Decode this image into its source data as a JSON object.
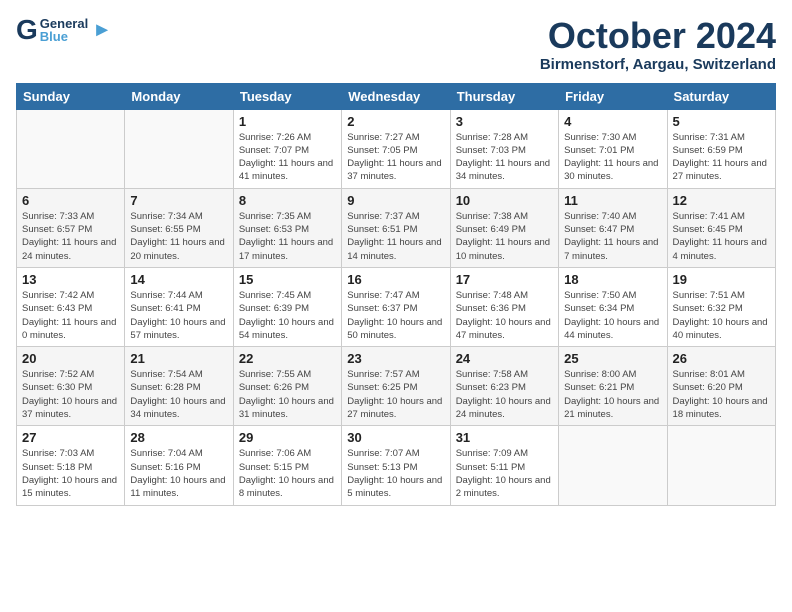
{
  "header": {
    "logo_general": "General",
    "logo_blue": "Blue",
    "month": "October 2024",
    "location": "Birmenstorf, Aargau, Switzerland"
  },
  "days_of_week": [
    "Sunday",
    "Monday",
    "Tuesday",
    "Wednesday",
    "Thursday",
    "Friday",
    "Saturday"
  ],
  "weeks": [
    [
      {
        "day": "",
        "info": ""
      },
      {
        "day": "",
        "info": ""
      },
      {
        "day": "1",
        "info": "Sunrise: 7:26 AM\nSunset: 7:07 PM\nDaylight: 11 hours and 41 minutes."
      },
      {
        "day": "2",
        "info": "Sunrise: 7:27 AM\nSunset: 7:05 PM\nDaylight: 11 hours and 37 minutes."
      },
      {
        "day": "3",
        "info": "Sunrise: 7:28 AM\nSunset: 7:03 PM\nDaylight: 11 hours and 34 minutes."
      },
      {
        "day": "4",
        "info": "Sunrise: 7:30 AM\nSunset: 7:01 PM\nDaylight: 11 hours and 30 minutes."
      },
      {
        "day": "5",
        "info": "Sunrise: 7:31 AM\nSunset: 6:59 PM\nDaylight: 11 hours and 27 minutes."
      }
    ],
    [
      {
        "day": "6",
        "info": "Sunrise: 7:33 AM\nSunset: 6:57 PM\nDaylight: 11 hours and 24 minutes."
      },
      {
        "day": "7",
        "info": "Sunrise: 7:34 AM\nSunset: 6:55 PM\nDaylight: 11 hours and 20 minutes."
      },
      {
        "day": "8",
        "info": "Sunrise: 7:35 AM\nSunset: 6:53 PM\nDaylight: 11 hours and 17 minutes."
      },
      {
        "day": "9",
        "info": "Sunrise: 7:37 AM\nSunset: 6:51 PM\nDaylight: 11 hours and 14 minutes."
      },
      {
        "day": "10",
        "info": "Sunrise: 7:38 AM\nSunset: 6:49 PM\nDaylight: 11 hours and 10 minutes."
      },
      {
        "day": "11",
        "info": "Sunrise: 7:40 AM\nSunset: 6:47 PM\nDaylight: 11 hours and 7 minutes."
      },
      {
        "day": "12",
        "info": "Sunrise: 7:41 AM\nSunset: 6:45 PM\nDaylight: 11 hours and 4 minutes."
      }
    ],
    [
      {
        "day": "13",
        "info": "Sunrise: 7:42 AM\nSunset: 6:43 PM\nDaylight: 11 hours and 0 minutes."
      },
      {
        "day": "14",
        "info": "Sunrise: 7:44 AM\nSunset: 6:41 PM\nDaylight: 10 hours and 57 minutes."
      },
      {
        "day": "15",
        "info": "Sunrise: 7:45 AM\nSunset: 6:39 PM\nDaylight: 10 hours and 54 minutes."
      },
      {
        "day": "16",
        "info": "Sunrise: 7:47 AM\nSunset: 6:37 PM\nDaylight: 10 hours and 50 minutes."
      },
      {
        "day": "17",
        "info": "Sunrise: 7:48 AM\nSunset: 6:36 PM\nDaylight: 10 hours and 47 minutes."
      },
      {
        "day": "18",
        "info": "Sunrise: 7:50 AM\nSunset: 6:34 PM\nDaylight: 10 hours and 44 minutes."
      },
      {
        "day": "19",
        "info": "Sunrise: 7:51 AM\nSunset: 6:32 PM\nDaylight: 10 hours and 40 minutes."
      }
    ],
    [
      {
        "day": "20",
        "info": "Sunrise: 7:52 AM\nSunset: 6:30 PM\nDaylight: 10 hours and 37 minutes."
      },
      {
        "day": "21",
        "info": "Sunrise: 7:54 AM\nSunset: 6:28 PM\nDaylight: 10 hours and 34 minutes."
      },
      {
        "day": "22",
        "info": "Sunrise: 7:55 AM\nSunset: 6:26 PM\nDaylight: 10 hours and 31 minutes."
      },
      {
        "day": "23",
        "info": "Sunrise: 7:57 AM\nSunset: 6:25 PM\nDaylight: 10 hours and 27 minutes."
      },
      {
        "day": "24",
        "info": "Sunrise: 7:58 AM\nSunset: 6:23 PM\nDaylight: 10 hours and 24 minutes."
      },
      {
        "day": "25",
        "info": "Sunrise: 8:00 AM\nSunset: 6:21 PM\nDaylight: 10 hours and 21 minutes."
      },
      {
        "day": "26",
        "info": "Sunrise: 8:01 AM\nSunset: 6:20 PM\nDaylight: 10 hours and 18 minutes."
      }
    ],
    [
      {
        "day": "27",
        "info": "Sunrise: 7:03 AM\nSunset: 5:18 PM\nDaylight: 10 hours and 15 minutes."
      },
      {
        "day": "28",
        "info": "Sunrise: 7:04 AM\nSunset: 5:16 PM\nDaylight: 10 hours and 11 minutes."
      },
      {
        "day": "29",
        "info": "Sunrise: 7:06 AM\nSunset: 5:15 PM\nDaylight: 10 hours and 8 minutes."
      },
      {
        "day": "30",
        "info": "Sunrise: 7:07 AM\nSunset: 5:13 PM\nDaylight: 10 hours and 5 minutes."
      },
      {
        "day": "31",
        "info": "Sunrise: 7:09 AM\nSunset: 5:11 PM\nDaylight: 10 hours and 2 minutes."
      },
      {
        "day": "",
        "info": ""
      },
      {
        "day": "",
        "info": ""
      }
    ]
  ]
}
